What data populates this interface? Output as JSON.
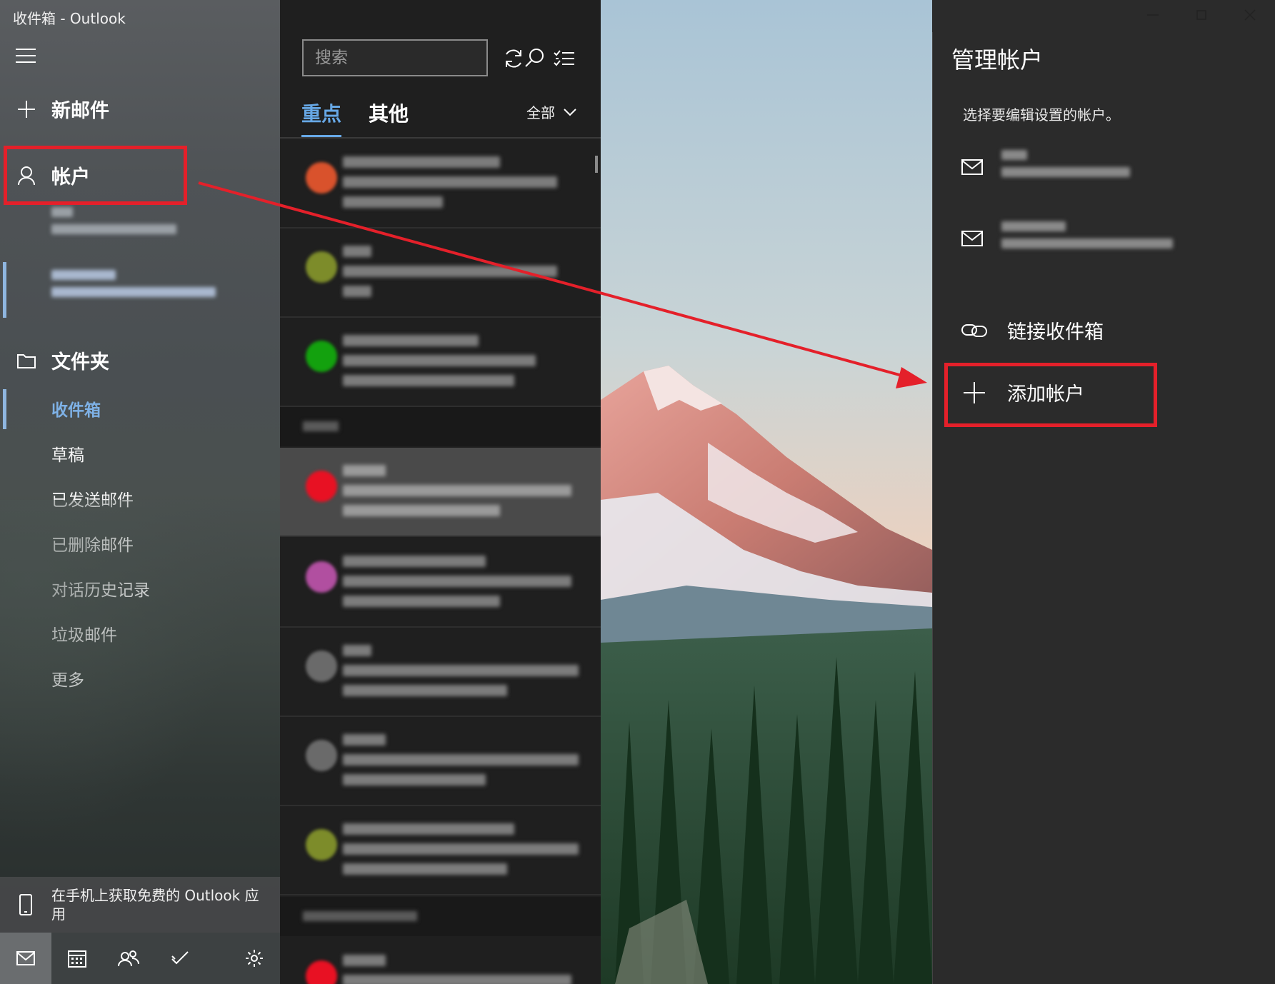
{
  "window": {
    "title": "收件箱 - Outlook"
  },
  "nav": {
    "new_mail": "新邮件",
    "accounts": "帐户",
    "folders_header": "文件夹",
    "folders": [
      {
        "label": "收件箱",
        "active": true
      },
      {
        "label": "草稿"
      },
      {
        "label": "已发送邮件"
      },
      {
        "label": "已删除邮件"
      },
      {
        "label": "对话历史记录"
      },
      {
        "label": "垃圾邮件"
      },
      {
        "label": "更多"
      }
    ],
    "promo_text": "在手机上获取免费的 Outlook 应用",
    "bottom_icons": [
      "mail-icon",
      "calendar-icon",
      "people-icon",
      "todo-icon",
      "settings-icon"
    ]
  },
  "list": {
    "search_placeholder": "搜索",
    "tabs": [
      "重点",
      "其他"
    ],
    "filter": "全部"
  },
  "flyout": {
    "title": "管理帐户",
    "subtitle": "选择要编辑设置的帐户。",
    "link_inboxes": "链接收件箱",
    "add_account": "添加帐户"
  },
  "colors": {
    "accent": "#67a8e6",
    "highlight": "#e4202a"
  }
}
